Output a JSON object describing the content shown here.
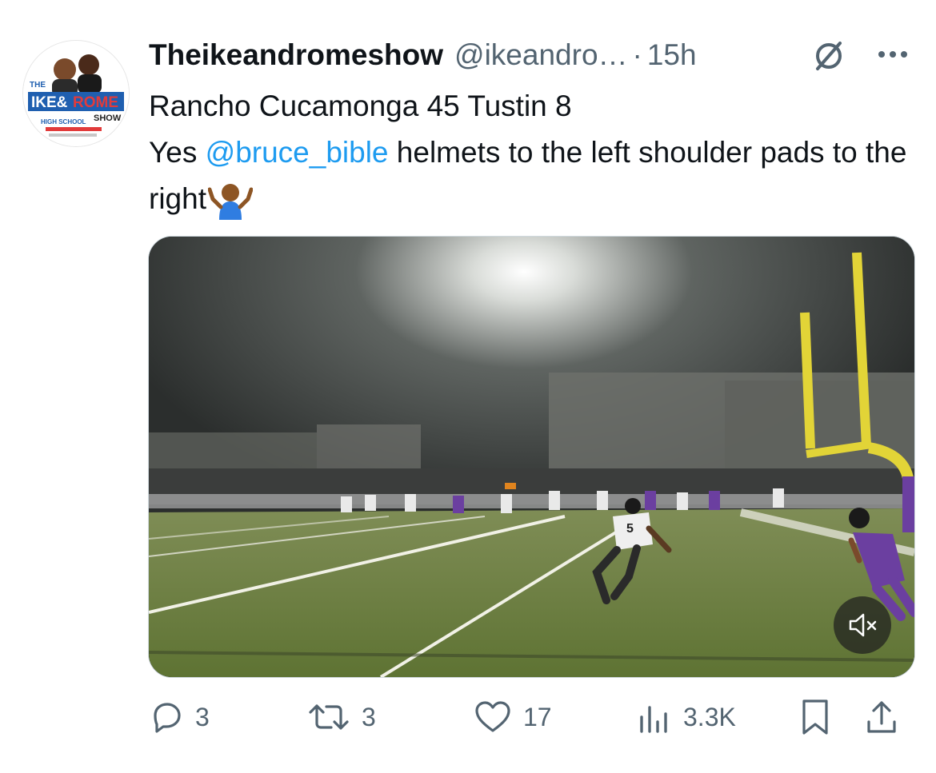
{
  "tweet": {
    "display_name": "Theikeandromeshow",
    "handle": "@ikeandro…",
    "separator": "·",
    "time": "15h",
    "text_line1": "Rancho Cucamonga 45 Tustin 8",
    "text_yes": "Yes ",
    "mention": "@bruce_bible",
    "text_rest": " helmets to the left shoulder pads to the right",
    "emoji": "person-shrugging-emoji"
  },
  "avatar": {
    "logo_text_the": "THE",
    "logo_text_ike": "IKE",
    "logo_text_rome": "ROME",
    "logo_text_show": "SHOW",
    "logo_text_highschool": "HIGH SCHOOL"
  },
  "actions": {
    "replies": "3",
    "reposts": "3",
    "likes": "17",
    "views": "3.3K"
  },
  "icons": {
    "more": "more-icon",
    "grok": "grok-icon",
    "mute": "volume-muted-icon",
    "reply": "reply-icon",
    "repost": "repost-icon",
    "like": "heart-icon",
    "views": "analytics-icon",
    "bookmark": "bookmark-icon",
    "share": "share-icon"
  },
  "colors": {
    "link": "#1d9bf0",
    "secondary_text": "#536471",
    "goalpost": "#e2d437",
    "jersey_purple": "#6b3fa0"
  }
}
